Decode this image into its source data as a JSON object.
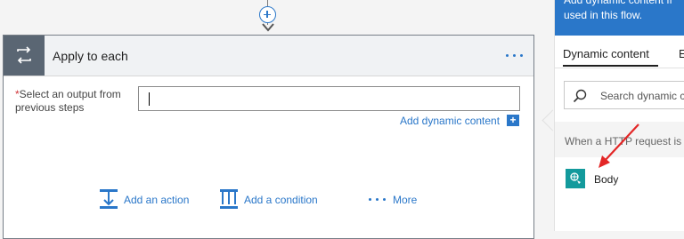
{
  "flow": {
    "add_step_icon": "plus-circle-icon",
    "card": {
      "title": "Apply to each",
      "icon": "loop-icon",
      "field": {
        "required_marker": "*",
        "label": "Select an output from previous steps",
        "value": ""
      },
      "add_dynamic_content": "Add dynamic content",
      "add_dynamic_icon": "+",
      "actions": [
        {
          "label": "Add an action",
          "icon": "add-action-icon"
        },
        {
          "label": "Add a condition",
          "icon": "add-condition-icon"
        },
        {
          "label": "More",
          "icon": "more-dots-icon"
        }
      ]
    }
  },
  "panel": {
    "banner_line1": "Add dynamic content fr",
    "banner_line2": "used in this flow.",
    "tabs": [
      {
        "label": "Dynamic content",
        "selected": true
      },
      {
        "label": "E",
        "selected": false
      }
    ],
    "search_placeholder": "Search dynamic c",
    "section_title": "When a HTTP request is",
    "token": {
      "label": "Body",
      "color": "#139a9c"
    }
  },
  "colors": {
    "accent": "#2a77c9",
    "annotation_arrow": "#e32626"
  }
}
